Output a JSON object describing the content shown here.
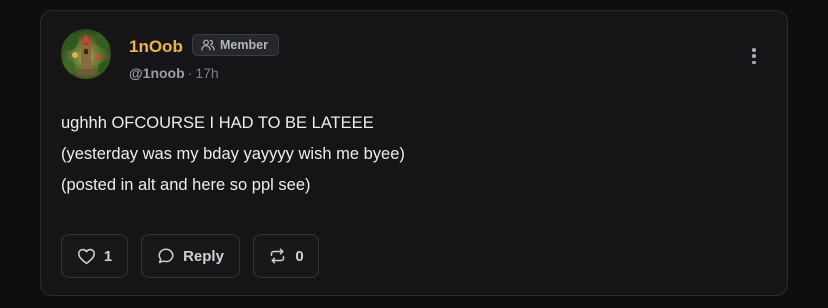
{
  "post": {
    "author": {
      "display_name": "1nOob",
      "role": "Member",
      "handle": "@1noob",
      "separator": "·",
      "time_ago": "17h"
    },
    "body_lines": [
      "ughhh OFCOURSE I HAD TO BE LATEEE",
      "(yesterday was my bday yayyyy wish me byee)",
      "(posted in alt and here so ppl see)"
    ],
    "actions": {
      "like_count": "1",
      "reply_label": "Reply",
      "repost_count": "0"
    }
  },
  "icons": {
    "role_badge": "users-icon",
    "more": "vertical-dots-icon",
    "like": "heart-icon",
    "reply": "speech-bubble-icon",
    "repost": "repost-arrows-icon"
  },
  "colors": {
    "page_background": "#0e0e10",
    "card_background": "#151518",
    "username": "#f3b52c",
    "body_text": "#ededed",
    "muted_text": "#9a9da4"
  }
}
